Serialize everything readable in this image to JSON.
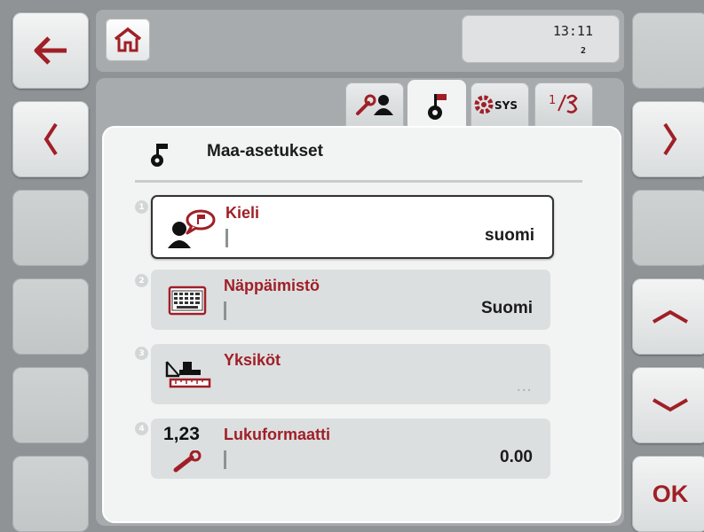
{
  "header": {
    "time": "13:11",
    "page_indicator": "2"
  },
  "tabs": [
    {
      "icon": "wrench-user-icon"
    },
    {
      "icon": "country-flag-globe-icon",
      "active": true
    },
    {
      "icon": "system-gear-icon",
      "text": "SYS"
    },
    {
      "icon": "info-diagnostics-icon"
    }
  ],
  "panel": {
    "title": "Maa-asetukset"
  },
  "settings": [
    {
      "number": "1",
      "label": "Kieli",
      "value": "suomi",
      "icon": "language-speech-icon"
    },
    {
      "number": "2",
      "label": "Näppäimistö",
      "value": "Suomi",
      "icon": "keyboard-icon"
    },
    {
      "number": "3",
      "label": "Yksiköt",
      "value": "...",
      "icon": "units-scale-icon"
    },
    {
      "number": "4",
      "label": "Lukuformaatti",
      "value": "0.00",
      "icon_text": "1,23",
      "icon": "number-format-icon"
    }
  ],
  "softkeys": {
    "ok_label": "OK"
  },
  "colors": {
    "accent": "#a01f27",
    "background": "#8f9396",
    "panel": "#f2f3f3"
  }
}
